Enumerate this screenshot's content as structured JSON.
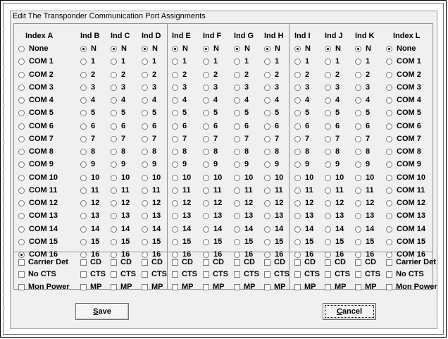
{
  "dialog": {
    "title": "Edit The Transponder Communication Port Assignments"
  },
  "columns": [
    {
      "id": "index-a",
      "header": "Index A",
      "type": "com",
      "none_label": "None",
      "selected": "COM 16"
    },
    {
      "id": "ind-b",
      "header": "Ind B",
      "type": "num",
      "none_label": "N",
      "selected": "N"
    },
    {
      "id": "ind-c",
      "header": "Ind C",
      "type": "num",
      "none_label": "N",
      "selected": "N"
    },
    {
      "id": "ind-d",
      "header": "Ind D",
      "type": "num",
      "none_label": "N",
      "selected": "N"
    },
    {
      "id": "ind-e",
      "header": "Ind E",
      "type": "num",
      "none_label": "N",
      "selected": "N"
    },
    {
      "id": "ind-f",
      "header": "Ind F",
      "type": "num",
      "none_label": "N",
      "selected": "N"
    },
    {
      "id": "ind-g",
      "header": "Ind G",
      "type": "num",
      "none_label": "N",
      "selected": "N"
    },
    {
      "id": "ind-h",
      "header": "Ind H",
      "type": "num",
      "none_label": "N",
      "selected": "N"
    },
    {
      "id": "ind-i",
      "header": "Ind I",
      "type": "num",
      "none_label": "N",
      "selected": "N"
    },
    {
      "id": "ind-j",
      "header": "Ind J",
      "type": "num",
      "none_label": "N",
      "selected": "N"
    },
    {
      "id": "ind-k",
      "header": "Ind K",
      "type": "num",
      "none_label": "N",
      "selected": "N"
    },
    {
      "id": "index-l",
      "header": "Index L",
      "type": "com",
      "none_label": "None",
      "selected": "None"
    }
  ],
  "com_options": [
    "COM 1",
    "COM 2",
    "COM 3",
    "COM 4",
    "COM 5",
    "COM 6",
    "COM 7",
    "COM 8",
    "COM 9",
    "COM 10",
    "COM 11",
    "COM 12",
    "COM 13",
    "COM 14",
    "COM 15",
    "COM 16"
  ],
  "num_options": [
    "1",
    "2",
    "3",
    "4",
    "5",
    "6",
    "7",
    "8",
    "9",
    "10",
    "11",
    "12",
    "13",
    "14",
    "15",
    "16"
  ],
  "checkboxes": {
    "row1": {
      "index_a": "Carrier Det",
      "ind": "CD",
      "index_l": "Carrier Det"
    },
    "row2": {
      "index_a": "No CTS",
      "ind": "CTS",
      "index_l": "No CTS"
    },
    "row3": {
      "index_a": "Mon Power",
      "ind": "MP",
      "index_l": "Mon Power"
    }
  },
  "buttons": {
    "save_prefix": "S",
    "save_rest": "ave",
    "cancel_prefix": "C",
    "cancel_rest": "ancel"
  },
  "colors": {
    "dialog_bg": "#f0f0f0",
    "border": "#8f8f8f",
    "text": "#000000"
  }
}
